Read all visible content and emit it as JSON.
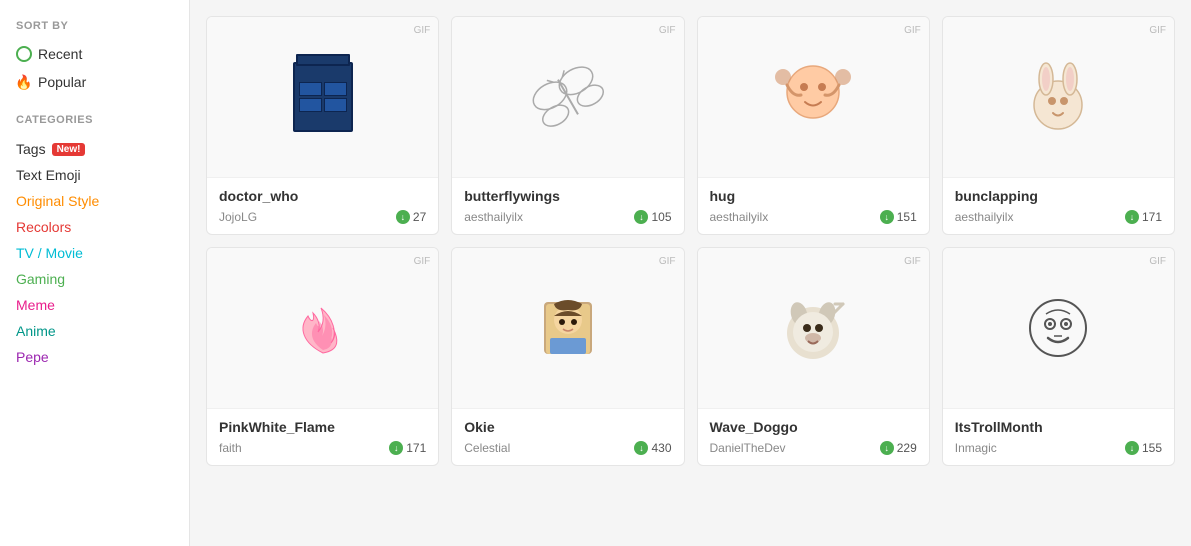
{
  "sidebar": {
    "sort_by_label": "SORT BY",
    "sort_items": [
      {
        "id": "recent",
        "label": "Recent",
        "icon": "recent"
      },
      {
        "id": "popular",
        "label": "Popular",
        "icon": "popular"
      }
    ],
    "categories_label": "CATEGORIES",
    "categories": [
      {
        "id": "tags",
        "label": "Tags",
        "badge": "New!",
        "color": "default"
      },
      {
        "id": "text-emoji",
        "label": "Text Emoji",
        "color": "default"
      },
      {
        "id": "original-style",
        "label": "Original Style",
        "color": "orange"
      },
      {
        "id": "recolors",
        "label": "Recolors",
        "color": "red"
      },
      {
        "id": "tv-movie",
        "label": "TV / Movie",
        "color": "cyan"
      },
      {
        "id": "gaming",
        "label": "Gaming",
        "color": "green"
      },
      {
        "id": "meme",
        "label": "Meme",
        "color": "magenta"
      },
      {
        "id": "anime",
        "label": "Anime",
        "color": "teal"
      },
      {
        "id": "pepe",
        "label": "Pepe",
        "color": "purple"
      }
    ]
  },
  "grid": {
    "rows": [
      [
        {
          "id": "doctor_who",
          "title": "doctor_who",
          "author": "JojoLG",
          "downloads": 27,
          "gif": true,
          "icon": "tardis"
        },
        {
          "id": "butterflywings",
          "title": "butterflywings",
          "author": "aesthailyilx",
          "downloads": 105,
          "gif": true,
          "icon": "butterfly"
        },
        {
          "id": "hug",
          "title": "hug",
          "author": "aesthailyilx",
          "downloads": 151,
          "gif": true,
          "icon": "hug"
        },
        {
          "id": "bunclapping",
          "title": "bunclapping",
          "author": "aesthailyilx",
          "downloads": 171,
          "gif": true,
          "icon": "bunny"
        }
      ],
      [
        {
          "id": "pinkwhite_flame",
          "title": "PinkWhite_Flame",
          "author": "faith",
          "downloads": 171,
          "gif": true,
          "icon": "flame"
        },
        {
          "id": "okie",
          "title": "Okie",
          "author": "Celestial",
          "downloads": 430,
          "gif": true,
          "icon": "anime-girl"
        },
        {
          "id": "wave_doggo",
          "title": "Wave_Doggo",
          "author": "DanielTheDev",
          "downloads": 229,
          "gif": true,
          "icon": "dog"
        },
        {
          "id": "itstrollmonth",
          "title": "ItsTrollMonth",
          "author": "Inmagic",
          "downloads": 155,
          "gif": true,
          "icon": "troll"
        }
      ]
    ]
  }
}
